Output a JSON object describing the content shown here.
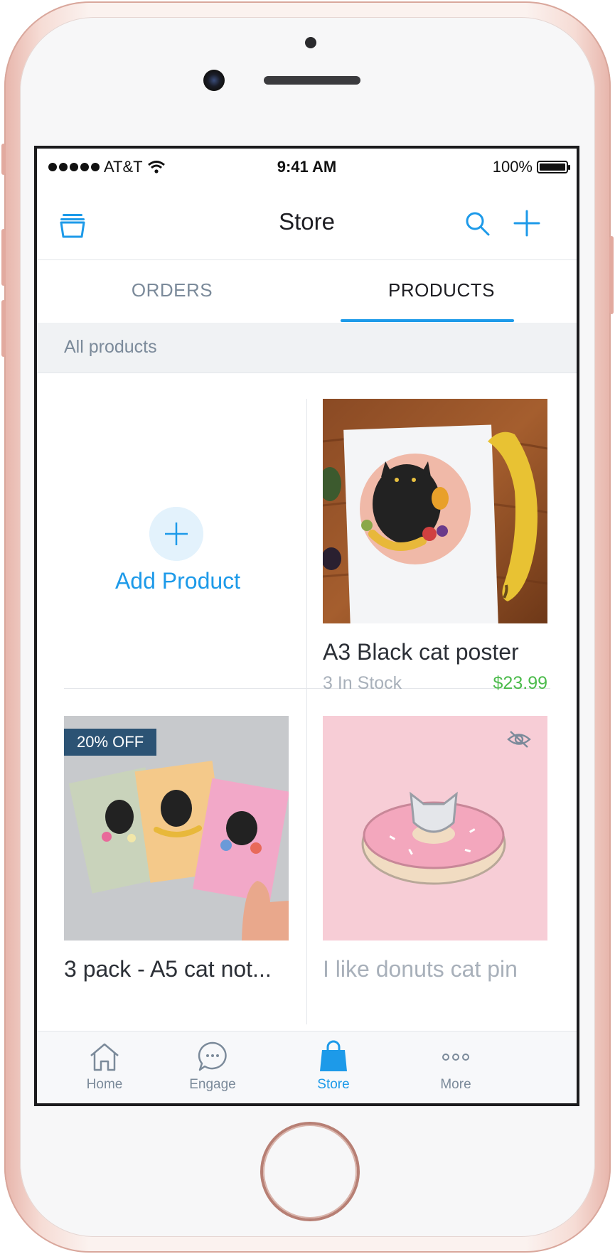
{
  "status_bar": {
    "carrier": "AT&T",
    "time": "9:41 AM",
    "battery": "100%"
  },
  "nav": {
    "title": "Store"
  },
  "tabs": [
    {
      "label": "ORDERS",
      "active": false
    },
    {
      "label": "PRODUCTS",
      "active": true
    }
  ],
  "section_label": "All products",
  "add_product": {
    "label": "Add Product"
  },
  "products": [
    {
      "name": "A3 Black cat poster",
      "stock": "3 In Stock",
      "price": "$23.99",
      "badge": "",
      "hidden": false
    },
    {
      "name": "3 pack - A5 cat not...",
      "stock": "",
      "price": "",
      "badge": "20% OFF",
      "hidden": false
    },
    {
      "name": "I like donuts cat pin",
      "stock": "",
      "price": "",
      "badge": "",
      "hidden": true
    }
  ],
  "tabbar": [
    {
      "label": "Home",
      "icon": "home-icon",
      "active": false
    },
    {
      "label": "Engage",
      "icon": "chat-bubble-icon",
      "active": false
    },
    {
      "label": "Store",
      "icon": "shopping-bag-icon",
      "active": true
    },
    {
      "label": "More",
      "icon": "more-dots-icon",
      "active": false
    }
  ],
  "colors": {
    "accent": "#1d9ae9",
    "price": "#4cbb4c",
    "badge": "#2c5374",
    "muted": "#7b8a9a"
  }
}
